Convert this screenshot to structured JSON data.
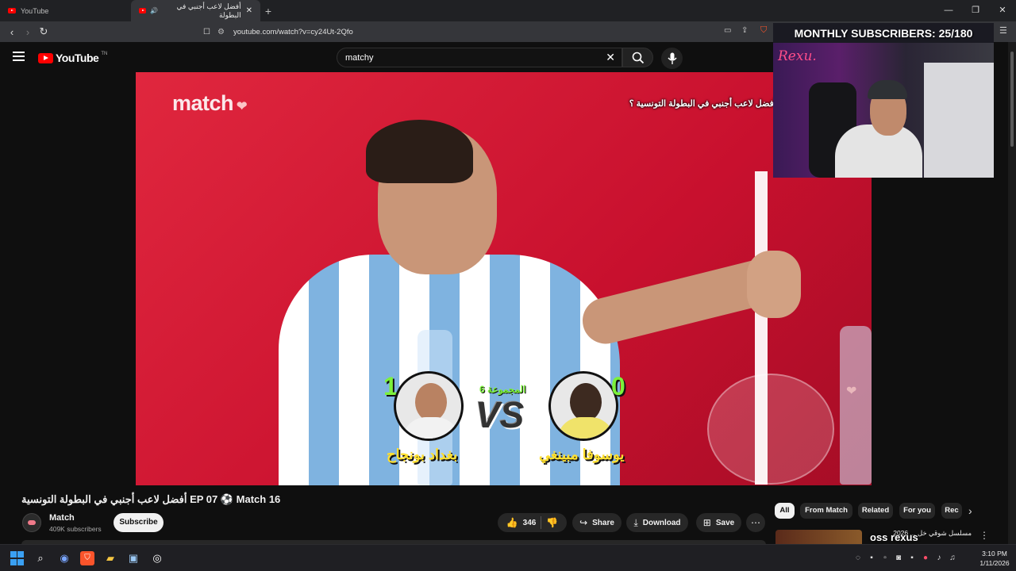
{
  "browser": {
    "tabs": [
      {
        "title": "YouTube",
        "active": false
      },
      {
        "title": "أفضل لاعب أجنبي في البطولة",
        "active": true
      }
    ],
    "new_tab": "+",
    "url": "youtube.com/watch?v=cy24Ut-2Qfo",
    "window_controls": [
      "—",
      "❐",
      "✕"
    ]
  },
  "youtube": {
    "logo_text": "YouTube",
    "logo_sup": "TN",
    "search_value": "matchy"
  },
  "video": {
    "brand": "match",
    "question": "أفضل لاعب أجنبي في البطولة التونسية ؟",
    "group_label": "المجموعة 6",
    "vs_text": "VS",
    "left_player": {
      "name": "بغداد بونجاح",
      "score": "1"
    },
    "right_player": {
      "name": "يوسوفا مبينغي",
      "score": "0"
    }
  },
  "stream_overlay": {
    "title": "MONTHLY SUBSCRIBERS: 25/180",
    "signature": "Rexu.",
    "chat_name": "oss rexus"
  },
  "details": {
    "title": "أفضل لاعب أجنبي في البطولة التونسية EP 07 ⚽ Match 16",
    "channel_name": "Match",
    "subscribers": "409K subscribers",
    "subscribe_label": "Subscribe",
    "likes": "346",
    "share_label": "Share",
    "download_label": "Download",
    "save_label": "Save"
  },
  "chips": [
    "All",
    "From Match",
    "Related",
    "For you",
    "Rec"
  ],
  "recommendation": {
    "title": "مسلسل شوقي خل ... 2026"
  },
  "taskbar": {
    "time": "3:10 PM",
    "date": "1/11/2026"
  },
  "colors": {
    "video_red": "#c8102e",
    "score_green": "#7cf23b",
    "name_yellow": "#ffdf2e",
    "yt_red": "#ff0000"
  }
}
